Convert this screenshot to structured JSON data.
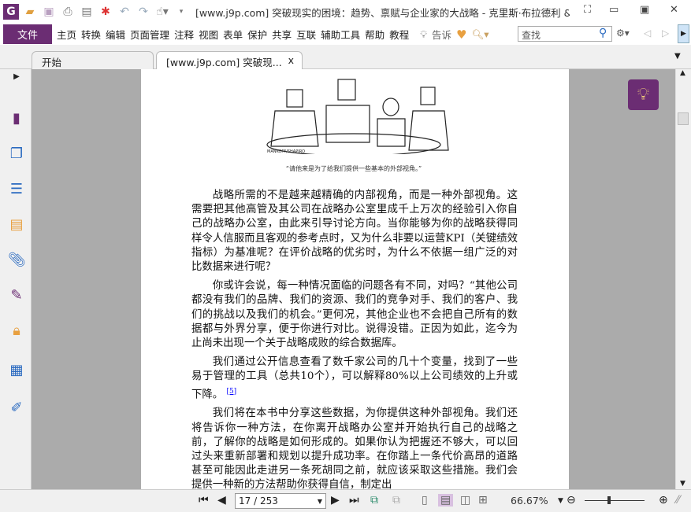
{
  "app": {
    "title": "[www.j9p.com] 突破现实的困境：趋势、禀赋与企业家的大战略 - 克里斯·布拉德利 & ...",
    "logo": "G"
  },
  "menu": {
    "file": "文件",
    "items": [
      "主页",
      "转换",
      "编辑",
      "页面管理",
      "注释",
      "视图",
      "表单",
      "保护",
      "共享",
      "互联",
      "辅助工具",
      "帮助",
      "教程"
    ],
    "tell": "告诉",
    "search_placeholder": "查找"
  },
  "tabs": [
    {
      "label": "开始"
    },
    {
      "label": "[www.j9p.com] 突破现...",
      "close": "x"
    }
  ],
  "document": {
    "caption": "“请他来是为了给我们提供一些基本的外部视角。”",
    "cartoon_signature": "MANKOFF/SHAPIRO",
    "paragraphs": [
      "战略所需的不是越来越精确的内部视角，而是一种外部视角。这需要把其他高管及其公司在战略办公室里成千上万次的经验引入你自己的战略办公室，由此来引导讨论方向。当你能够为你的战略获得同样令人信服而且客观的参考点时，又为什么非要以运营KPI（关键绩效指标）为基准呢？在评价战略的优劣时，为什么不依据一组广泛的对比数据来进行呢？",
      "你或许会说，每一种情况面临的问题各有不同，对吗？“其他公司都没有我们的品牌、我们的资源、我们的竞争对手、我们的客户、我们的挑战以及我们的机会。”更何况，其他企业也不会把自己所有的数据都与外界分享，便于你进行对比。说得没错。正因为如此，迄今为止尚未出现一个关于战略成败的综合数据库。",
      "我们通过公开信息查看了数千家公司的几十个变量，找到了一些易于管理的工具（总共10个），可以解释80%以上公司绩效的上升或下降。",
      "我们将在本书中分享这些数据，为你提供这种外部视角。我们还将告诉你一种方法，在你离开战略办公室并开始执行自己的战略之前，了解你的战略是如何形成的。如果你认为把握还不够大，可以回过头来重新部署和规划以提升成功率。在你踏上一条代价高昂的道路甚至可能因此走进另一条死胡同之前，就应该采取这些措施。我们会提供一种新的方法帮助你获得自信，制定出"
    ],
    "footnote": "[5]"
  },
  "status": {
    "page": "17 / 253",
    "zoom": "66.67%"
  }
}
